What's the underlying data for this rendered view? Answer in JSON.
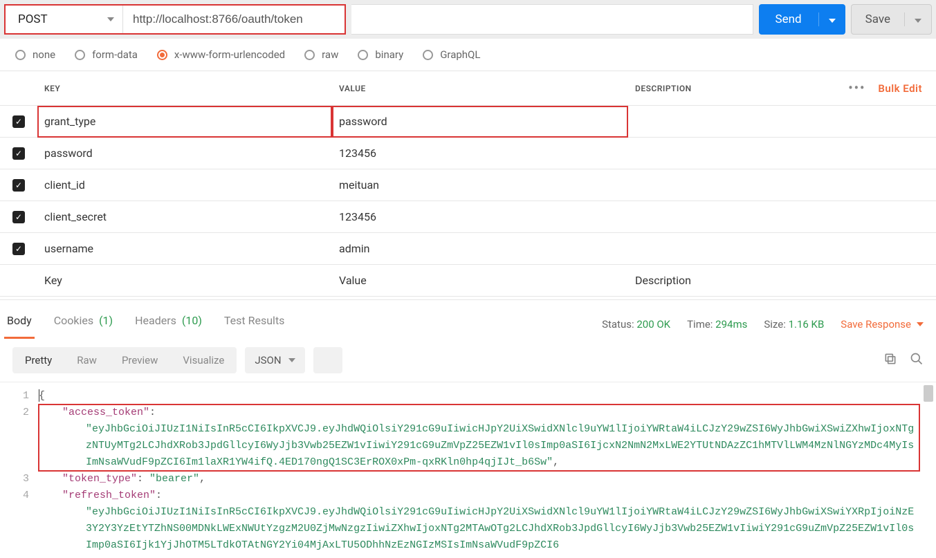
{
  "request": {
    "method": "POST",
    "url": "http://localhost:8766/oauth/token",
    "send_label": "Send",
    "save_label": "Save"
  },
  "body_types": [
    "none",
    "form-data",
    "x-www-form-urlencoded",
    "raw",
    "binary",
    "GraphQL"
  ],
  "body_type_selected": "x-www-form-urlencoded",
  "table": {
    "headers": {
      "key": "KEY",
      "value": "VALUE",
      "description": "DESCRIPTION"
    },
    "bulk_edit": "Bulk Edit",
    "rows": [
      {
        "key": "grant_type",
        "value": "password"
      },
      {
        "key": "password",
        "value": "123456"
      },
      {
        "key": "client_id",
        "value": "meituan"
      },
      {
        "key": "client_secret",
        "value": "123456"
      },
      {
        "key": "username",
        "value": "admin"
      }
    ],
    "placeholders": {
      "key": "Key",
      "value": "Value",
      "description": "Description"
    }
  },
  "response_tabs": {
    "body": "Body",
    "cookies": "Cookies",
    "cookies_count": "(1)",
    "headers": "Headers",
    "headers_count": "(10)",
    "test_results": "Test Results"
  },
  "response_meta": {
    "status_label": "Status:",
    "status_value": "200 OK",
    "time_label": "Time:",
    "time_value": "294ms",
    "size_label": "Size:",
    "size_value": "1.16 KB",
    "save_response": "Save Response"
  },
  "viewer": {
    "tabs": [
      "Pretty",
      "Raw",
      "Preview",
      "Visualize"
    ],
    "lang": "JSON"
  },
  "json_body": {
    "access_token_key": "\"access_token\"",
    "access_token_value": "\"eyJhbGciOiJIUzI1NiIsInR5cCI6IkpXVCJ9.eyJhdWQiOlsiY291cG9uIiwicHJpY2UiXSwidXNlcl9uYW1lIjoiYWRtaW4iLCJzY29wZSI6WyJhbGwiXSwiZXhwIjoxNTgzNTUyMTg2LCJhdXRob3JpdGllcyI6WyJjb3Vwb25EZW1vIiwiY291cG9uZmVpZ25EZW1vIl0sImp0aSI6IjcxN2NmN2MxLWE2YTUtNDAzZC1hMTVlLWM4MzNlNGYzMDc4MyIsImNsaWVudF9pZCI6Im1laXR1YW4ifQ.4ED170ngQ1SC3ErROX0xPm-qxRKln0hp4qjIJt_b6Sw\"",
    "token_type_key": "\"token_type\"",
    "token_type_value": "\"bearer\"",
    "refresh_token_key": "\"refresh_token\"",
    "refresh_token_value_partial": "\"eyJhbGciOiJIUzI1NiIsInR5cCI6IkpXVCJ9.eyJhdWQiOlsiY291cG9uIiwicHJpY2UiXSwidXNlcl9uYW1lIjoiYWRtaW4iLCJzY29wZSI6WyJhbGwiXSwiYXRpIjoiNzE3Y2Y3YzEtYTZhNS00MDNkLWExNWUtYzgzM2U0ZjMwNzgzIiwiZXhwIjoxNTg2MTAwOTg2LCJhdXRob3JpdGllcyI6WyJjb3Vwb25EZW1vIiwiY291cG9uZmVpZ25EZW1vIl0sImp0aSI6Ijk1YjJhOTM5LTdkOTAtNGY2Yi04MjAxLTU5ODhhNzEzNGIzMSIsImNsaWVudF9pZCI6"
  }
}
